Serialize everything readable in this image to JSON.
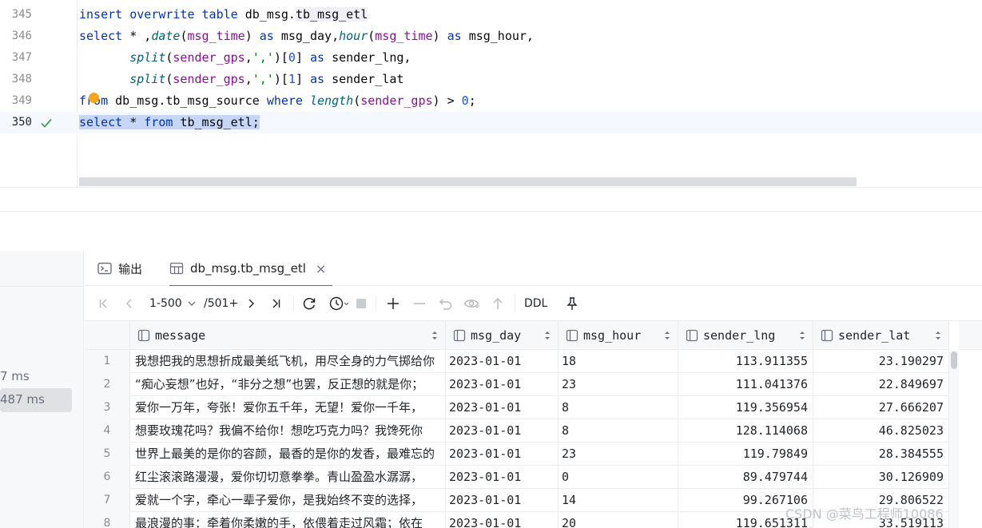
{
  "editor": {
    "lines": [
      {
        "num": "345",
        "tokens": [
          [
            "kw",
            "insert "
          ],
          [
            "kw",
            "overwrite "
          ],
          [
            "kw",
            "table "
          ],
          [
            "",
            "db_msg."
          ],
          [
            "hl",
            "tb_msg_etl"
          ]
        ]
      },
      {
        "num": "346",
        "tokens": [
          [
            "kw",
            "select "
          ],
          [
            "",
            "* ,"
          ],
          [
            "fn",
            "date"
          ],
          [
            "",
            "("
          ],
          [
            "id",
            "msg_time"
          ],
          [
            "",
            ") "
          ],
          [
            "kw",
            "as "
          ],
          [
            "",
            "msg_day,"
          ],
          [
            "fn",
            "hour"
          ],
          [
            "",
            "("
          ],
          [
            "id",
            "msg_time"
          ],
          [
            "",
            ") "
          ],
          [
            "kw",
            "as "
          ],
          [
            "",
            "msg_hour,"
          ]
        ]
      },
      {
        "num": "347",
        "tokens": [
          [
            "",
            "       "
          ],
          [
            "fn",
            "split"
          ],
          [
            "",
            "("
          ],
          [
            "id",
            "sender_gps"
          ],
          [
            "",
            ","
          ],
          [
            "str",
            "','"
          ],
          [
            "",
            ")["
          ],
          [
            "num",
            "0"
          ],
          [
            "",
            "] "
          ],
          [
            "kw",
            "as "
          ],
          [
            "",
            "sender_lng,"
          ]
        ]
      },
      {
        "num": "348",
        "tokens": [
          [
            "",
            "       "
          ],
          [
            "fn",
            "split"
          ],
          [
            "",
            "("
          ],
          [
            "id",
            "sender_gps"
          ],
          [
            "",
            ","
          ],
          [
            "str",
            "','"
          ],
          [
            "",
            ")["
          ],
          [
            "num",
            "1"
          ],
          [
            "",
            "] "
          ],
          [
            "kw",
            "as "
          ],
          [
            "",
            "sender_lat"
          ]
        ]
      },
      {
        "num": "349",
        "tokens": [
          [
            "kw",
            "from "
          ],
          [
            "",
            "db_msg.tb_msg_source "
          ],
          [
            "kw",
            "where "
          ],
          [
            "fn",
            "length"
          ],
          [
            "",
            "("
          ],
          [
            "id",
            "sender_gps"
          ],
          [
            "",
            ") > "
          ],
          [
            "num",
            "0"
          ],
          [
            "",
            ";"
          ]
        ]
      },
      {
        "num": "350",
        "tokens": [
          [
            "selkw",
            "select "
          ],
          [
            "sel",
            "* "
          ],
          [
            "selkw",
            "from "
          ],
          [
            "sel",
            "tb_msg_etl;"
          ]
        ],
        "current": true
      }
    ]
  },
  "timings": [
    "7 ms",
    "487 ms"
  ],
  "tabs": [
    {
      "label": "输出",
      "icon": "console-icon"
    },
    {
      "label": "db_msg.tb_msg_etl",
      "icon": "table-icon",
      "active": true
    }
  ],
  "toolbar": {
    "paging": "1-500",
    "total": "/501+",
    "ddl": "DDL"
  },
  "grid": {
    "columns": [
      "message",
      "msg_day",
      "msg_hour",
      "sender_lng",
      "sender_lat"
    ],
    "rows": [
      [
        "1",
        "我想把我的思想折成最美纸飞机，用尽全身的力气掷给你",
        "2023-01-01",
        "18",
        "113.911355",
        "23.190297"
      ],
      [
        "2",
        "“痴心妄想”也好，“非分之想”也罢，反正想的就是你；",
        "2023-01-01",
        "23",
        "111.041376",
        "22.849697"
      ],
      [
        "3",
        "爱你一万年，夸张！爱你五千年，无望！爱你一千年，",
        "2023-01-01",
        "8",
        "119.356954",
        "27.666207"
      ],
      [
        "4",
        "想要玫瑰花吗？我偏不给你！想吃巧克力吗？我馋死你",
        "2023-01-01",
        "8",
        "128.114068",
        "46.825023"
      ],
      [
        "5",
        "世界上最美的是你的容颜，最香的是你的发香，最难忘的",
        "2023-01-01",
        "23",
        "119.79849",
        "28.384555"
      ],
      [
        "6",
        "红尘滚滚路漫漫，爱你切切意拳拳。青山盈盈水潺潺，",
        "2023-01-01",
        "0",
        "89.479744",
        "30.126909"
      ],
      [
        "7",
        "爱就一个字，牵心一辈子爱你，是我始终不变的选择，",
        "2023-01-01",
        "14",
        "99.267106",
        "29.806522"
      ],
      [
        "8",
        "最浪漫的事：牵着你柔嫩的手，依偎着走过风霜；依在",
        "2023-01-01",
        "20",
        "119.651311",
        "33.519113"
      ]
    ]
  },
  "watermark": "CSDN @菜鸟工程师10086",
  "colors": {
    "accent": "#3574f0",
    "keyword": "#0033b3",
    "function": "#00627a",
    "identifier": "#871094",
    "string": "#067d17",
    "number": "#1750eb",
    "success": "#3fa34d"
  }
}
